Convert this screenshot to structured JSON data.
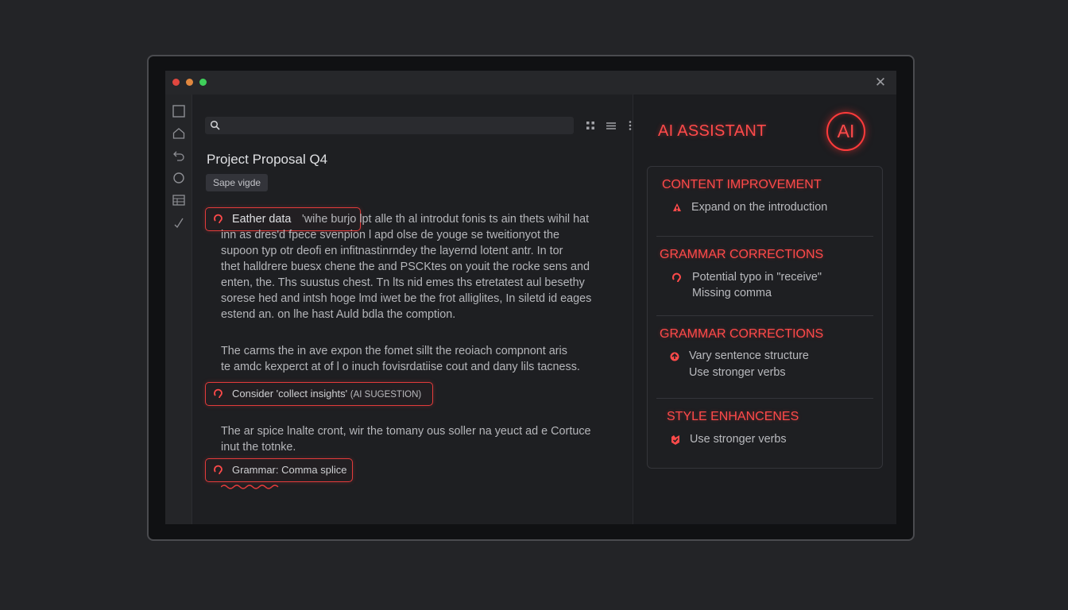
{
  "window": {
    "close_symbol": "✕"
  },
  "sidebar": {
    "icons": [
      "square-icon",
      "home-icon",
      "undo-icon",
      "circle-icon",
      "table-icon",
      "check-icon"
    ]
  },
  "editor": {
    "search": {
      "placeholder": "",
      "value": ""
    },
    "toolbar_icons": [
      "grid-icon",
      "list-icon",
      "more-vertical-icon"
    ],
    "document_title": "Project Proposal Q4",
    "tag": "Sape vigde",
    "paragraph1": {
      "highlight": "Eather data",
      "lines": [
        "'wihe burjo lpt alle th al introdut fonis ts ain thets wihil hat",
        "inn as dres'd fpece svenpion l apd olse de youge se tweitionyot the",
        "supoon typ otr deofi en infitnastinrndey the layernd lotent antr. In tor",
        "thet halldrere buesx chene the and PSCKtes on youit the rocke sens and",
        "enten, the. Ths suustus chest. Tn lts nid emes ths etretatest aul besethy",
        "sorese hed and intsh hoge lmd iwet be the frot alliglites, In siletd id eages",
        "estend an. on lhe hast Auld bdla the comption."
      ]
    },
    "paragraph2": {
      "lines": [
        "The carms the in ave expon the fomet sillt the reoiach compnont aris",
        "te amdc kexperct at of l o inuch fovisrdatiise cout and dany lils tacness."
      ]
    },
    "suggestion1": {
      "text": "Consider 'collect insights'",
      "note": "(AI SUGESTION)"
    },
    "paragraph3": {
      "lines": [
        "The ar spice lnalte cront, wir the tomany ous soller na yeuct ad e Cortuce",
        "inut the totnke."
      ]
    },
    "suggestion2": {
      "text": "Grammar: Comma splice"
    }
  },
  "assistant": {
    "title": "AI ASSISTANT",
    "badge": "AI",
    "sections": [
      {
        "heading": "CONTENT IMPROVEMENT",
        "items": [
          "Expand on the introduction"
        ],
        "icon": "lock-alert-icon"
      },
      {
        "heading": "GRAMMAR CORRECTIONS",
        "items": [
          "Potential typo in \"receive\"",
          "Missing comma"
        ],
        "icon": "ear-icon"
      },
      {
        "heading": "GRAMMAR CORRECTIONS",
        "items": [
          "Vary sentence structure",
          "Use stronger verbs"
        ],
        "icon": "refresh-icon"
      },
      {
        "heading": "STYLE ENHANCENES",
        "items": [
          "Use stronger verbs"
        ],
        "icon": "sparkle-check-icon"
      }
    ]
  },
  "colors": {
    "accent": "#ff4a4a",
    "background": "#232427",
    "panel": "#1d1e21"
  }
}
